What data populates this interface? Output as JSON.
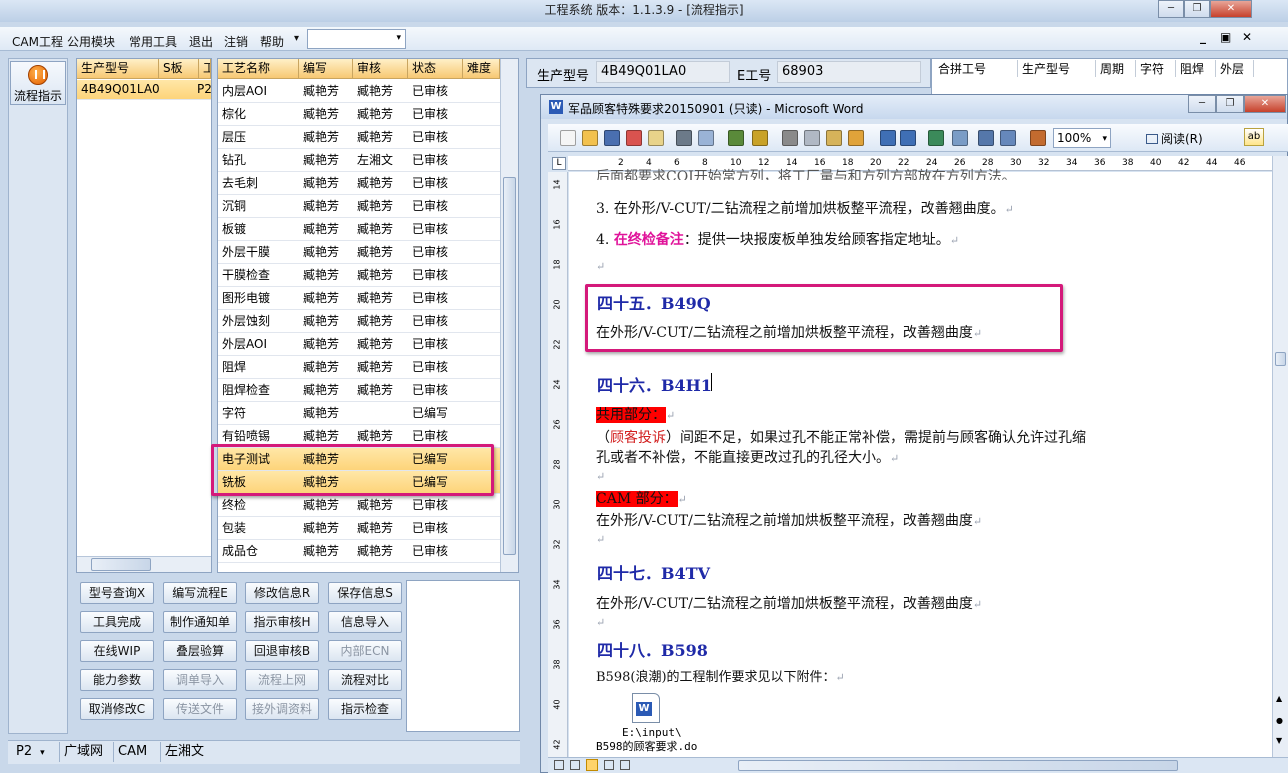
{
  "app": {
    "title": "工程系统   版本：1.1.3.9 - [流程指示]",
    "menu": [
      "CAM工程",
      "公用模块",
      "常用工具",
      "退出",
      "注销",
      "帮助"
    ],
    "help_arrow": "▾",
    "mdi_min": "_",
    "mdi_restore": "▣",
    "mdi_close": "✕",
    "win_min": "─",
    "win_restore": "❐",
    "win_close": "✕"
  },
  "left_tool": {
    "flow_label": "流程指示"
  },
  "model_list": {
    "headers": [
      "生产型号",
      "S板",
      "工"
    ],
    "rows": [
      [
        "4B49Q01LA0",
        "",
        "P2"
      ]
    ]
  },
  "process": {
    "headers": [
      "工艺名称",
      "编写",
      "审核",
      "状态",
      "难度"
    ],
    "rows": [
      [
        "内层AOI",
        "臧艳芳",
        "臧艳芳",
        "已审核"
      ],
      [
        "棕化",
        "臧艳芳",
        "臧艳芳",
        "已审核"
      ],
      [
        "层压",
        "臧艳芳",
        "臧艳芳",
        "已审核"
      ],
      [
        "钻孔",
        "臧艳芳",
        "左湘文",
        "已审核"
      ],
      [
        "去毛刺",
        "臧艳芳",
        "臧艳芳",
        "已审核"
      ],
      [
        "沉铜",
        "臧艳芳",
        "臧艳芳",
        "已审核"
      ],
      [
        "板镀",
        "臧艳芳",
        "臧艳芳",
        "已审核"
      ],
      [
        "外层干膜",
        "臧艳芳",
        "臧艳芳",
        "已审核"
      ],
      [
        "干膜检查",
        "臧艳芳",
        "臧艳芳",
        "已审核"
      ],
      [
        "图形电镀",
        "臧艳芳",
        "臧艳芳",
        "已审核"
      ],
      [
        "外层蚀刻",
        "臧艳芳",
        "臧艳芳",
        "已审核"
      ],
      [
        "外层AOI",
        "臧艳芳",
        "臧艳芳",
        "已审核"
      ],
      [
        "阻焊",
        "臧艳芳",
        "臧艳芳",
        "已审核"
      ],
      [
        "阻焊检查",
        "臧艳芳",
        "臧艳芳",
        "已审核"
      ],
      [
        "字符",
        "臧艳芳",
        "",
        "已编写"
      ],
      [
        "有铅喷锡",
        "臧艳芳",
        "臧艳芳",
        "已审核"
      ],
      [
        "电子测试",
        "臧艳芳",
        "",
        "已编写"
      ],
      [
        "铣板",
        "臧艳芳",
        "",
        "已编写"
      ],
      [
        "终检",
        "臧艳芳",
        "臧艳芳",
        "已审核"
      ],
      [
        "包装",
        "臧艳芳",
        "臧艳芳",
        "已审核"
      ],
      [
        "成品仓",
        "臧艳芳",
        "臧艳芳",
        "已审核"
      ]
    ]
  },
  "buttons": [
    [
      {
        "l": "型号查询X",
        "e": true
      },
      {
        "l": "编写流程E",
        "e": true
      },
      {
        "l": "修改信息R",
        "e": true
      },
      {
        "l": "保存信息S",
        "e": true
      }
    ],
    [
      {
        "l": "工具完成",
        "e": true
      },
      {
        "l": "制作通知单",
        "e": true
      },
      {
        "l": "指示审核H",
        "e": true
      },
      {
        "l": "信息导入",
        "e": true
      }
    ],
    [
      {
        "l": "在线WIP",
        "e": true
      },
      {
        "l": "叠层验算",
        "e": true
      },
      {
        "l": "回退审核B",
        "e": true
      },
      {
        "l": "内部ECN",
        "e": false
      }
    ],
    [
      {
        "l": "能力参数",
        "e": true
      },
      {
        "l": "调单导入",
        "e": false
      },
      {
        "l": "流程上网",
        "e": false
      },
      {
        "l": "流程对比",
        "e": true
      }
    ],
    [
      {
        "l": "取消修改C",
        "e": true
      },
      {
        "l": "传送文件",
        "e": false
      },
      {
        "l": "接外调资料",
        "e": false
      },
      {
        "l": "指示检查",
        "e": true
      }
    ]
  ],
  "bottom_tabs": {
    "selector": "P2",
    "tabs": [
      "广域网",
      "CAM",
      "左湘文"
    ]
  },
  "info": {
    "model_label": "生产型号",
    "model_value": "4B49Q01LA0",
    "eno_label": "E工号",
    "eno_value": "68903",
    "merge_headers": [
      "合拼工号",
      "生产型号",
      "周期",
      "字符",
      "阻焊",
      "外层"
    ]
  },
  "word": {
    "title": "军品顾客特殊要求20150901 (只读) - Microsoft Word",
    "zoom": "100%",
    "read_label": "阅读(R)",
    "ruler_ticks": [
      "2",
      "4",
      "6",
      "8",
      "10",
      "12",
      "14",
      "16",
      "18",
      "20",
      "22",
      "24",
      "26",
      "28",
      "30",
      "32",
      "34",
      "36",
      "38",
      "40",
      "42",
      "44",
      "46"
    ],
    "vruler_ticks": [
      "14",
      "16",
      "18",
      "20",
      "22",
      "24",
      "26",
      "28",
      "30",
      "32",
      "34",
      "36",
      "38",
      "40",
      "42"
    ],
    "top_partial": "后面都要求COI开始常方列，将工厂量与和方列方部放在方列方法。",
    "item3": "3. 在外形/V-CUT/二钻流程之前增加烘板整平流程，改善翘曲度。",
    "item4_num": "4. ",
    "item4_emph": "在终检备注",
    "item4_rest": "：提供一块报废板单独发给顾客指定地址。",
    "h45": "四十五．B49Q",
    "p45": "在外形/V-CUT/二钻流程之前增加烘板整平流程，改善翘曲度",
    "h46": "四十六．B4H1",
    "shared": "共用部分：",
    "complaint_open": "（",
    "complaint": "顾客投诉",
    "complaint_rest": "）间距不足，如果过孔不能正常补偿，需提前与顾客确认允许过孔缩",
    "complaint_line2": "孔或者不补偿，不能直接更改过孔的孔径大小。",
    "cam_part": "CAM 部分：",
    "p46b": "在外形/V-CUT/二钻流程之前增加烘板整平流程，改善翘曲度",
    "h47": "四十七．B4TV",
    "p47": "在外形/V-CUT/二钻流程之前增加烘板整平流程，改善翘曲度",
    "h48": "四十八．B598",
    "p48": "B598(浪潮)的工程制作要求见以下附件：",
    "attach_path": "E:\\input\\",
    "attach_name": "B598的顾客要求.do",
    "para_mark": "↵"
  }
}
